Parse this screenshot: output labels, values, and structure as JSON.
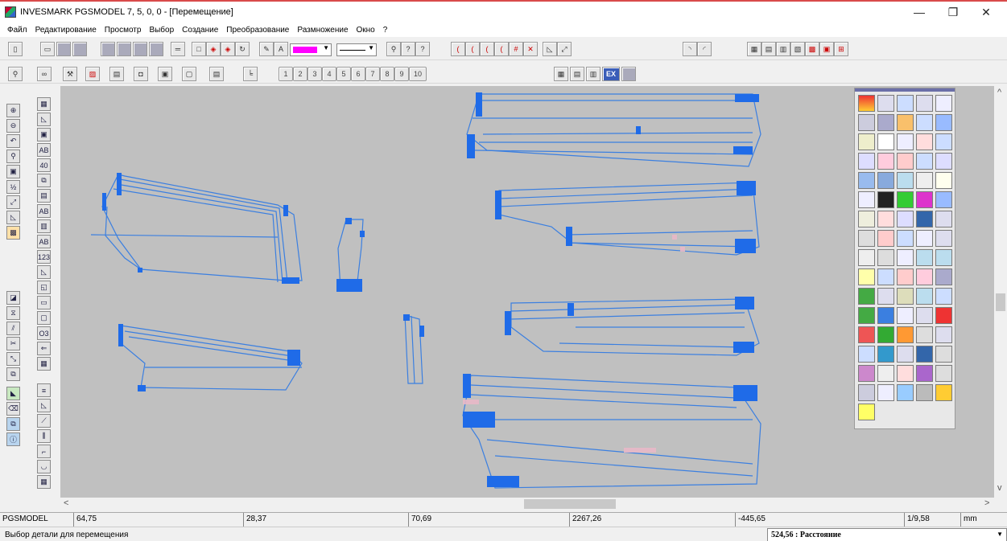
{
  "window": {
    "title": "INVESMARK PGSMODEL  7, 5, 0, 0 - [Перемещение]",
    "minimize_glyph": "—",
    "maximize_glyph": "❐",
    "close_glyph": "✕"
  },
  "menu": [
    "Файл",
    "Редактирование",
    "Просмотр",
    "Выбор",
    "Создание",
    "Преобразование",
    "Размножение",
    "Окно",
    "?"
  ],
  "toolbar": {
    "number_buttons": [
      "1",
      "2",
      "3",
      "4",
      "5",
      "6",
      "7",
      "8",
      "9",
      "10"
    ],
    "ex_label": "EX"
  },
  "left_tools": {
    "labels": [
      "AB",
      "40",
      "AB",
      "AB",
      "123",
      "O3"
    ]
  },
  "scroll": {
    "left_arrow": "<",
    "right_arrow": ">",
    "up_arrow": "^",
    "down_arrow": "v"
  },
  "status": {
    "model": "PGSMODEL",
    "v1": "64,75",
    "v2": "28,37",
    "v3": "70,69",
    "v4": "2267,26",
    "v5": "-445,65",
    "scale": "1/9,58",
    "units": "mm"
  },
  "hint": "Выбор детали для перемещения",
  "distance": "524,56 : Расстояние",
  "distance_dropdown": "▼",
  "colors": {
    "canvas_bg": "#c0c0c0",
    "pattern_line": "#3b7fe0",
    "pattern_anchor": "#1f6be8",
    "window_border": "#d94a4a"
  }
}
